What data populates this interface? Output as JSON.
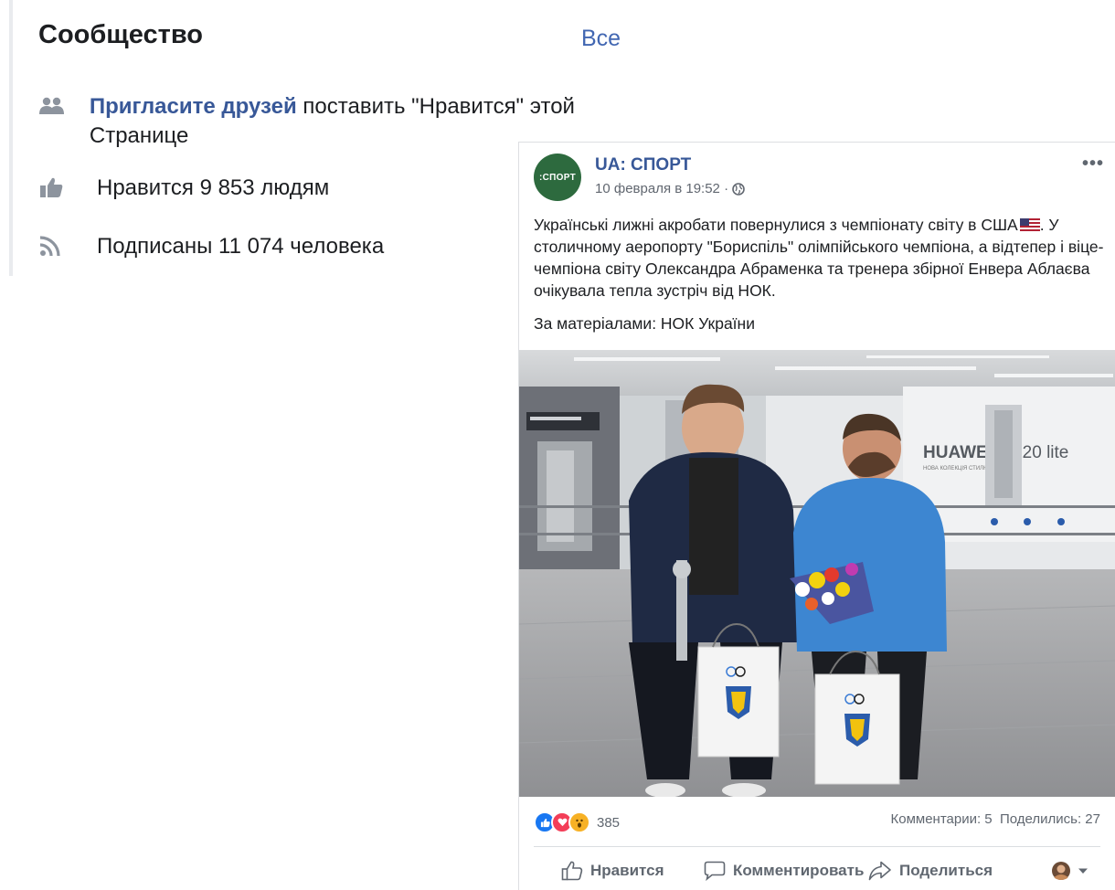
{
  "community": {
    "title": "Сообщество",
    "all_link": "Все",
    "invite_link": "Пригласите друзей",
    "invite_rest": " поставить \"Нравится\" этой Странице",
    "likes": "Нравится 9 853 людям",
    "followers": "Подписаны 11 074 человека"
  },
  "post": {
    "avatar_text": ":СПОРТ",
    "page_name": "UA: СПОРТ",
    "timestamp": "10 февраля в 19:52 ·",
    "text": "Українські лижні акробати повернулися з чемпіонату світу в США",
    "text_cont": "У столичному аеропорту \"Бориспіль\" олімпійського чемпіона, а відтепер і віце-чемпіона світу Олександра Абраменка та тренера збірної Енвера Аблаєва очікувала тепла зустріч від НОК.",
    "source": "За матеріалами: НОК України",
    "photo": {
      "billboard_brand": "HUAWEI",
      "billboard_model": "P20 lite",
      "billboard_sub": "НОВА КОЛЕКЦІЯ СТИЛЮ"
    },
    "reaction_count": "385",
    "comments": "Комментарии: 5",
    "shares": "Поделились: 27",
    "actions": {
      "like": "Нравится",
      "comment": "Комментировать",
      "share": "Поделиться"
    }
  },
  "colors": {
    "link": "#385898",
    "accent": "#4267b2",
    "like_blue": "#1877f2",
    "love_red": "#f33e58",
    "wow_yellow": "#f7b125"
  }
}
